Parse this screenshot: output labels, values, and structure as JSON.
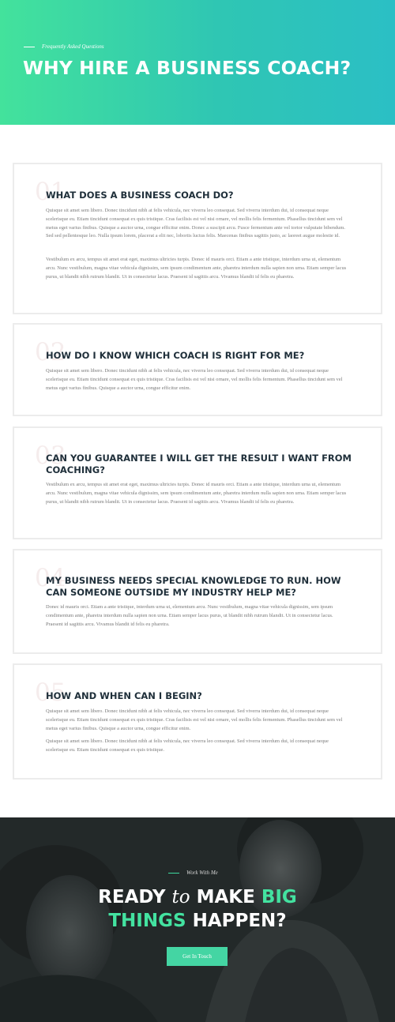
{
  "hero": {
    "kicker": "Frequently Asked Questions",
    "title": "WHY HIRE A BUSINESS COACH?"
  },
  "faqs": [
    {
      "number": "01",
      "question": "WHAT DOES A BUSINESS COACH DO?",
      "paragraphs": [
        "Quisque sit amet sem libero. Donec tincidunt nibh at felis vehicula, nec viverra leo consequat. Sed viverra interdum dui, id consequat neque scelerisque eu. Etiam tincidunt consequat ex quis tristique. Cras facilisis est vel nisi ornare, vel mollis felis fermentum. Phasellus tincidunt sem vel metus eget varius finibus. Quisque a auctor urna, congue efficitur enim. Donec a suscipit arcu. Fusce fermentum ante vel tortor vulputate bibendum. Sed sed pellentesque leo. Nulla ipsum lorem, placerat a elit nec, lobortis luctus felis. Maecenas finibus sagittis justo, ac laoreet augue molestie id.",
        "Vestibulum ex arcu, tempus sit amet erat eget, maximus ultricies turpis. Donec id mauris orci. Etiam a ante tristique, interdum urna ut, elementum arcu. Nunc vestibulum, magna vitae vehicula dignissim, sem ipsum condimentum ante, pharetra interdum nulla sapien non urna. Etiam semper lacus purus, ut blandit nibh rutrum blandit. Ut in consectetur lacus. Praesent id sagittis arcu. Vivamus blandit id felis eu pharetra."
      ]
    },
    {
      "number": "02",
      "question": "HOW DO I KNOW WHICH COACH IS RIGHT FOR ME?",
      "paragraphs": [
        "Quisque sit amet sem libero. Donec tincidunt nibh at felis vehicula, nec viverra leo consequat. Sed viverra interdum dui, id consequat neque scelerisque eu. Etiam tincidunt consequat ex quis tristique. Cras facilisis est vel nisi ornare, vel mollis felis fermentum. Phasellus tincidunt sem vel metus eget varius finibus. Quisque a auctor urna, congue efficitur enim."
      ]
    },
    {
      "number": "03",
      "question": "CAN YOU GUARANTEE I WILL GET THE RESULT I WANT FROM COACHING?",
      "paragraphs": [
        "Vestibulum ex arcu, tempus sit amet erat eget, maximus ultricies turpis. Donec id mauris orci. Etiam a ante tristique, interdum urna ut, elementum arcu. Nunc vestibulum, magna vitae vehicula dignissim, sem ipsum condimentum ante, pharetra interdum nulla sapien non urna. Etiam semper lacus purus, ut blandit nibh rutrum blandit. Ut in consectetur lacus. Praesent id sagittis arcu. Vivamus blandit id felis eu pharetra."
      ]
    },
    {
      "number": "04",
      "question": "MY BUSINESS NEEDS SPECIAL KNOWLEDGE TO RUN. HOW CAN SOMEONE OUTSIDE MY INDUSTRY HELP ME?",
      "paragraphs": [
        "Donec id mauris orci. Etiam a ante tristique, interdum urna ut, elementum arcu. Nunc vestibulum, magna vitae vehicula dignissim, sem ipsum condimentum ante, pharetra interdum nulla sapien non urna. Etiam semper lacus purus, ut blandit nibh rutrum blandit. Ut in consectetur lacus. Praesent id sagittis arcu. Vivamus blandit id felis eu pharetra."
      ]
    },
    {
      "number": "05",
      "question": "HOW AND WHEN CAN I BEGIN?",
      "paragraphs": [
        "Quisque sit amet sem libero. Donec tincidunt nibh at felis vehicula, nec viverra leo consequat. Sed viverra interdum dui, id consequat neque scelerisque eu. Etiam tincidunt consequat ex quis tristique. Cras facilisis est vel nisi ornare, vel mollis felis fermentum. Phasellus tincidunt sem vel metus eget varius finibus. Quisque a auctor urna, congue efficitur enim.",
        "Quisque sit amet sem libero. Donec tincidunt nibh at felis vehicula, nec viverra leo consequat. Sed viverra interdum dui, id consequat neque scelerisque eu. Etiam tincidunt consequat ex quis tristique."
      ]
    }
  ],
  "cta": {
    "kicker": "Work With Me",
    "title_ready": "READY",
    "title_to": "to",
    "title_make": "MAKE",
    "title_big": "BIG",
    "title_things": "THINGS",
    "title_happen": "HAPPEN?",
    "button": "Get In Touch"
  },
  "colors": {
    "accent": "#43e2a0",
    "heading": "#1f2f3a",
    "body_text": "#7a7a7a"
  }
}
